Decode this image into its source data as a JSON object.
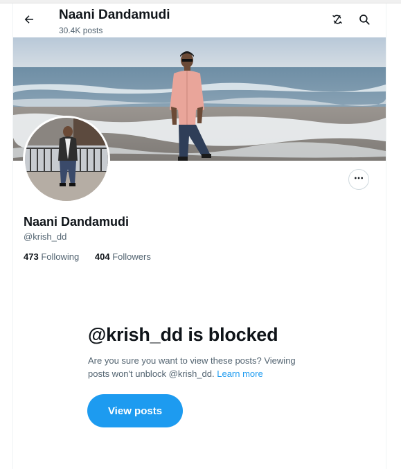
{
  "header": {
    "back_icon": "arrow-left-icon",
    "title": "Naani Dandamudi",
    "posts_count": "30.4K posts",
    "icons": [
      "refresh-icon",
      "search-icon"
    ]
  },
  "profile": {
    "name": "Naani Dandamudi",
    "handle": "@krish_dd",
    "more_icon": "ellipsis-icon",
    "following_count": "473",
    "following_label": "Following",
    "followers_count": "404",
    "followers_label": "Followers"
  },
  "blocked": {
    "title": "@krish_dd is blocked",
    "message": "Are you sure you want to view these posts? Viewing posts won't unblock @krish_dd.",
    "learn_more": "Learn more",
    "button_label": "View posts"
  },
  "colors": {
    "accent": "#1d9bf0",
    "text_primary": "#0f1419",
    "text_secondary": "#536471",
    "border": "#eff3f4"
  }
}
